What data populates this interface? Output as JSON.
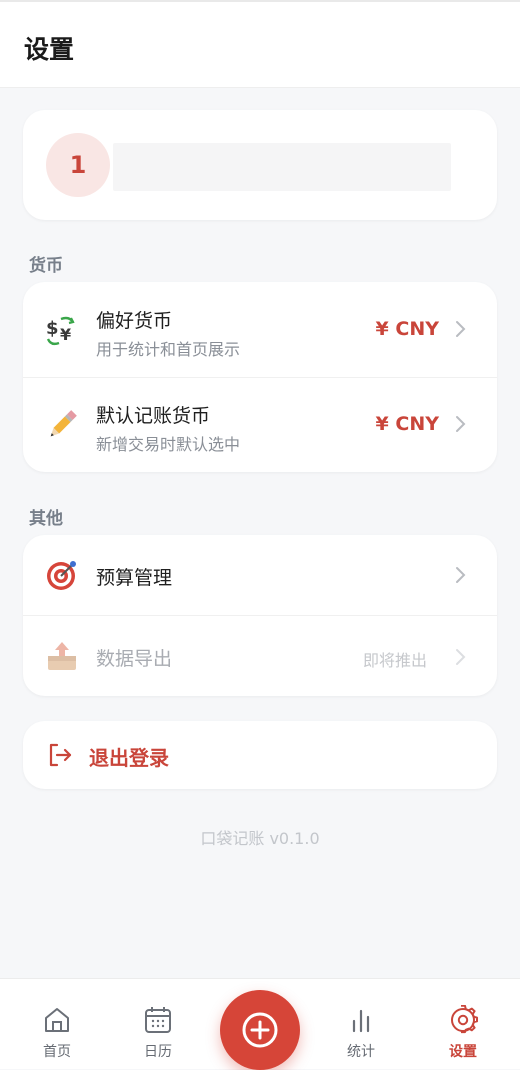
{
  "header": {
    "title": "设置"
  },
  "profile": {
    "avatar_text": "1"
  },
  "sections": {
    "currency": {
      "label": "货币",
      "items": [
        {
          "title": "偏好货币",
          "subtitle": "用于统计和首页展示",
          "value": "¥ CNY",
          "icon": "currency-exchange-icon"
        },
        {
          "title": "默认记账货币",
          "subtitle": "新增交易时默认选中",
          "value": "¥ CNY",
          "icon": "pencil-icon"
        }
      ]
    },
    "other": {
      "label": "其他",
      "items": [
        {
          "title": "预算管理",
          "icon": "target-icon"
        },
        {
          "title": "数据导出",
          "badge": "即将推出",
          "icon": "inbox-tray-icon"
        }
      ]
    }
  },
  "logout": {
    "label": "退出登录"
  },
  "version": "口袋记账 v0.1.0",
  "tabbar": {
    "home": "首页",
    "calendar": "日历",
    "stats": "统计",
    "settings": "设置"
  },
  "colors": {
    "accent": "#c9453a",
    "fab": "#d64538",
    "background": "#f6f7f9"
  }
}
